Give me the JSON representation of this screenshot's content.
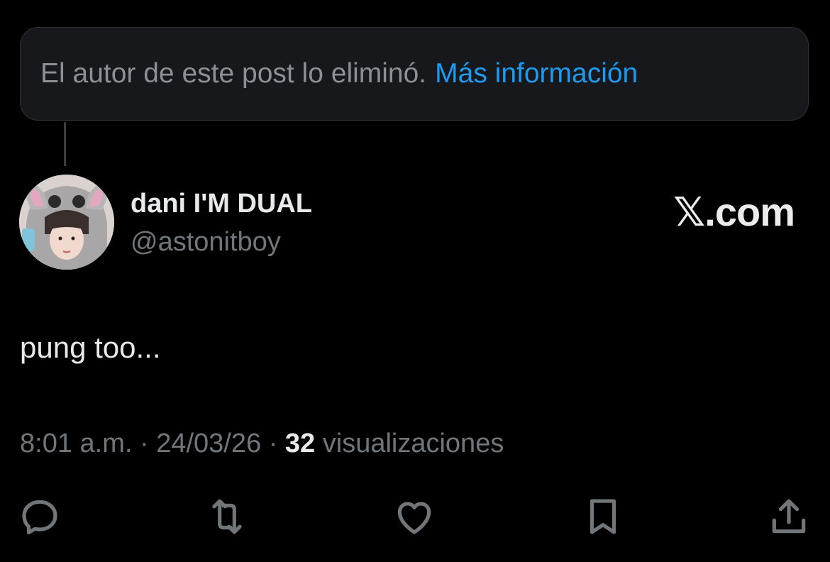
{
  "deleted_notice": {
    "text": "El autor de este post lo eliminó.",
    "link_label": "Más información"
  },
  "post": {
    "author_name": "dani I'M DUAL",
    "author_handle": "@astonitboy",
    "brand": "𝕏.com",
    "text": "pung too...",
    "time": "8:01 a.m.",
    "date": "24/03/26",
    "separator": "·",
    "views_count": "32",
    "views_label": "visualizaciones"
  },
  "actions": [
    {
      "name": "reply-icon"
    },
    {
      "name": "repost-icon"
    },
    {
      "name": "like-icon"
    },
    {
      "name": "bookmark-icon"
    },
    {
      "name": "share-icon"
    }
  ],
  "colors": {
    "background": "#000000",
    "link": "#1d9bf0",
    "secondary_text": "#71767b",
    "primary_text": "#e7e9ea"
  }
}
